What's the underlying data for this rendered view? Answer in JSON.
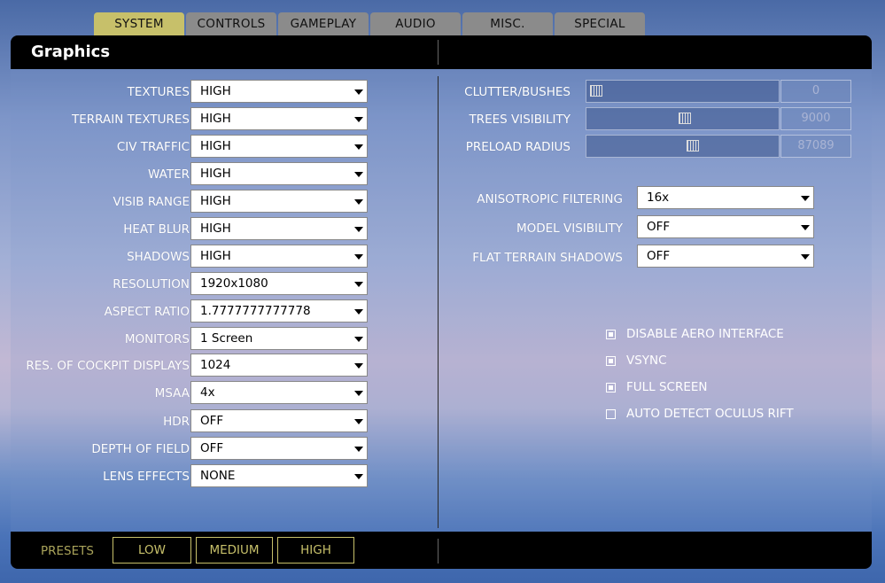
{
  "tabs": [
    "SYSTEM",
    "CONTROLS",
    "GAMEPLAY",
    "AUDIO",
    "MISC.",
    "SPECIAL"
  ],
  "active_tab": "SYSTEM",
  "panel": {
    "title": "Graphics"
  },
  "left_settings": [
    {
      "label": "TEXTURES",
      "value": "HIGH"
    },
    {
      "label": "TERRAIN TEXTURES",
      "value": "HIGH"
    },
    {
      "label": "CIV TRAFFIC",
      "value": "HIGH"
    },
    {
      "label": "WATER",
      "value": "HIGH"
    },
    {
      "label": "VISIB RANGE",
      "value": "HIGH"
    },
    {
      "label": "HEAT BLUR",
      "value": "HIGH"
    },
    {
      "label": "SHADOWS",
      "value": "HIGH"
    },
    {
      "label": "RESOLUTION",
      "value": "1920x1080"
    },
    {
      "label": "ASPECT RATIO",
      "value": "1.7777777777778"
    },
    {
      "label": "MONITORS",
      "value": "1 Screen"
    },
    {
      "label": "RES. OF COCKPIT DISPLAYS",
      "value": "1024"
    },
    {
      "label": "MSAA",
      "value": "4x"
    },
    {
      "label": "HDR",
      "value": "OFF"
    },
    {
      "label": "DEPTH OF FIELD",
      "value": "OFF"
    },
    {
      "label": "LENS EFFECTS",
      "value": "NONE"
    }
  ],
  "sliders": [
    {
      "label": "CLUTTER/BUSHES",
      "value": "0",
      "fraction": 0.0
    },
    {
      "label": "TREES VISIBILITY",
      "value": "9000",
      "fraction": 0.5
    },
    {
      "label": "PRELOAD RADIUS",
      "value": "87089",
      "fraction": 0.55
    }
  ],
  "right_settings": [
    {
      "label": "ANISOTROPIC FILTERING",
      "value": "16x"
    },
    {
      "label": "MODEL VISIBILITY",
      "value": "OFF"
    },
    {
      "label": "FLAT TERRAIN SHADOWS",
      "value": "OFF"
    }
  ],
  "checkboxes": [
    {
      "label": "DISABLE AERO INTERFACE",
      "checked": true
    },
    {
      "label": "VSYNC",
      "checked": true
    },
    {
      "label": "FULL SCREEN",
      "checked": true
    },
    {
      "label": "AUTO DETECT OCULUS RIFT",
      "checked": false
    }
  ],
  "footer": {
    "presets_label": "PRESETS",
    "presets": [
      "LOW",
      "MEDIUM",
      "HIGH"
    ]
  },
  "colors": {
    "accent": "#c7c06a",
    "header": "#000000",
    "tab": "#8b8b8b"
  }
}
